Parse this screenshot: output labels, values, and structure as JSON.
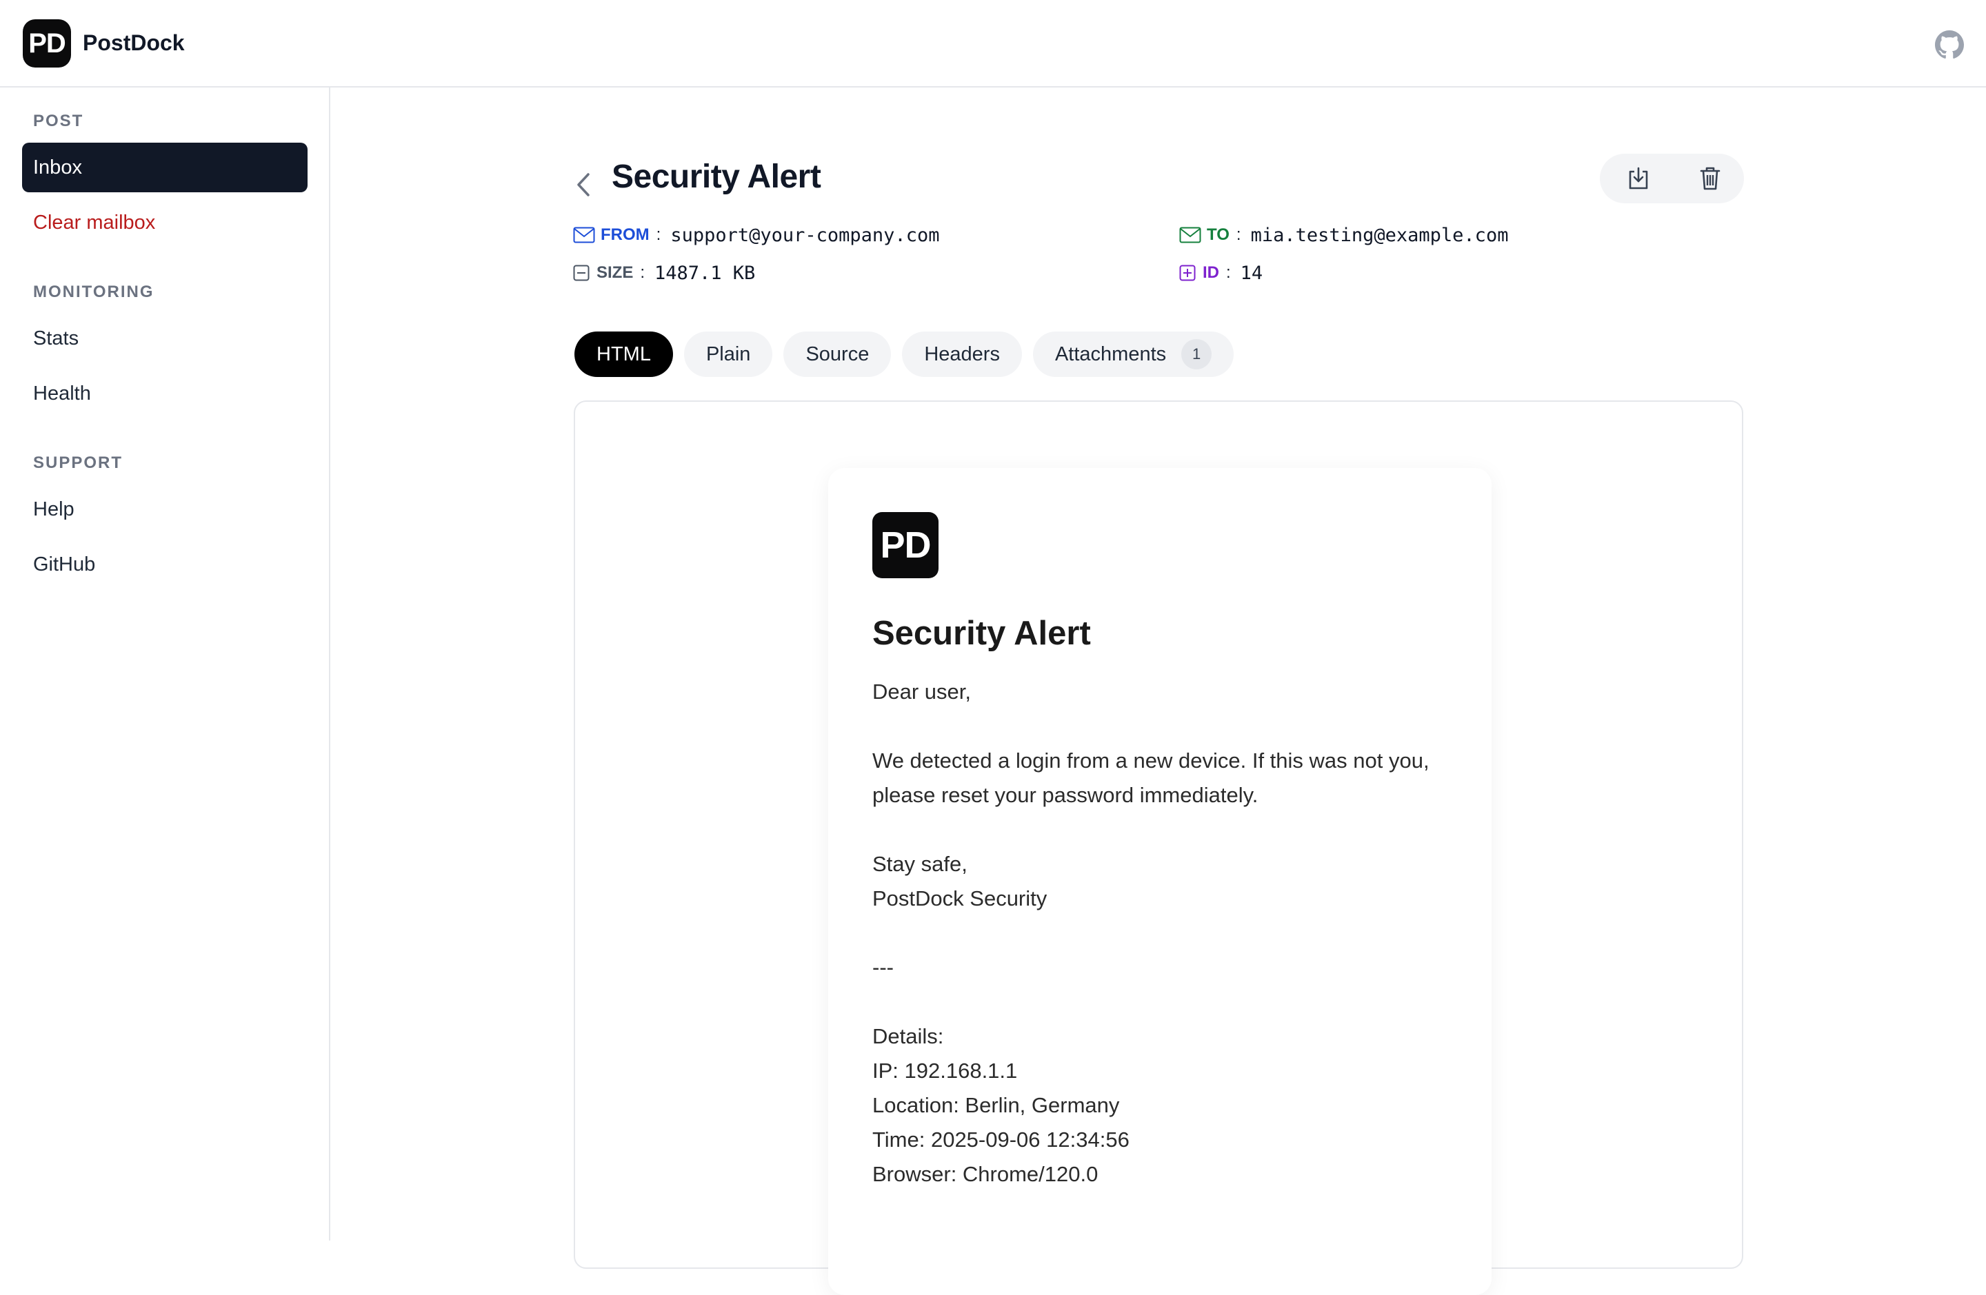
{
  "app": {
    "logo_text": "PD",
    "name": "PostDock"
  },
  "sidebar": {
    "sections": [
      {
        "title": "POST",
        "items": [
          {
            "label": "Inbox",
            "active": true
          },
          {
            "label": "Clear mailbox",
            "danger": true
          }
        ]
      },
      {
        "title": "MONITORING",
        "items": [
          {
            "label": "Stats"
          },
          {
            "label": "Health"
          }
        ]
      },
      {
        "title": "SUPPORT",
        "items": [
          {
            "label": "Help"
          },
          {
            "label": "GitHub"
          }
        ]
      }
    ]
  },
  "message": {
    "title": "Security Alert",
    "from_label": "FROM",
    "from_value": "support@your-company.com",
    "to_label": "TO",
    "to_value": "mia.testing@example.com",
    "size_label": "SIZE",
    "size_value": "1487.1 KB",
    "id_label": "ID",
    "id_value": "14"
  },
  "tabs": [
    {
      "label": "HTML",
      "active": true
    },
    {
      "label": "Plain"
    },
    {
      "label": "Source"
    },
    {
      "label": "Headers"
    },
    {
      "label": "Attachments",
      "badge": "1"
    }
  ],
  "email": {
    "logo_text": "PD",
    "title": "Security Alert",
    "greeting": "Dear user,",
    "paragraph": "We detected a login from a new device. If this was not you, please reset your password immediately.",
    "signoff_1": "Stay safe,",
    "signoff_2": "PostDock Security",
    "separator": "---",
    "details_heading": "Details:",
    "details": [
      "IP: 192.168.1.1",
      "Location: Berlin, Germany",
      "Time: 2025-09-06 12:34:56",
      "Browser: Chrome/120.0"
    ]
  },
  "colors": {
    "from": "#1d4ed8",
    "to": "#15803d",
    "size": "#4b5563",
    "id": "#7e22ce",
    "danger": "#b91c1c",
    "active_nav": "#111827"
  },
  "icons": {
    "github": "github-icon",
    "back": "chevron-left-icon",
    "download": "download-icon",
    "delete": "trash-icon",
    "from": "mail-icon",
    "to": "mail-icon",
    "size": "minus-square-icon",
    "id": "plus-square-icon"
  }
}
